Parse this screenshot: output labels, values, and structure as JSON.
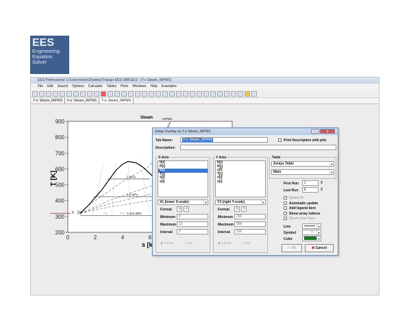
{
  "logo": {
    "title": "EES",
    "lines": [
      "Engineering",
      "Equation",
      "Solver"
    ]
  },
  "window": {
    "title": "EES Professional: C:\\Users\\koke\\Desktop\\Trabajo-EES-UBB.EES - [T-s Steam_IAPWS]",
    "menu": [
      "File",
      "Edit",
      "Search",
      "Options",
      "Calculate",
      "Tables",
      "Plots",
      "Windows",
      "Help",
      "Examples"
    ],
    "toolbar_icons": [
      "open-icon",
      "save-icon",
      "print-icon",
      "find-icon",
      "cut-icon",
      "copy-icon",
      "paste-icon",
      "equations-icon",
      "formatted-icon",
      "solution-icon",
      "check-icon",
      "calculator-icon",
      "table-icon",
      "plot-icon",
      "lookup-icon",
      "diagram-icon",
      "window1-icon",
      "window2-icon",
      "window3-icon",
      "window4-icon",
      "window5-icon",
      "window6-icon",
      "window7-icon",
      "window8-icon",
      "window9-icon",
      "window10-icon",
      "window11-icon",
      "window12-icon",
      "window13-icon",
      "window14-icon",
      "window15-icon",
      "help-icon",
      "report-icon"
    ],
    "tabs": [
      {
        "label": "T-s: Steam_IAPWS",
        "active": false
      },
      {
        "label": "h-s: Steam_IAPWS",
        "active": false
      },
      {
        "label": "T-s: Steam_IAPWS",
        "active": true
      }
    ]
  },
  "plot": {
    "title": "Steam",
    "title_sub": "IAPWS",
    "xlabel": "s [kJ/kg-K]",
    "ylabel": "T [K]",
    "xticks": [
      "0",
      "2",
      "4",
      "6"
    ],
    "yticks": [
      "200",
      "300",
      "400",
      "500",
      "600",
      "700",
      "800",
      "900"
    ],
    "isobar_labels": [
      "5 MPa",
      "0,5 MPa",
      "0,005 MPa"
    ],
    "quality_labels": [
      "0,2",
      "0,4",
      "0,6"
    ],
    "vline_label": "0,0058",
    "legend_label": "6",
    "legend_index": "[1]",
    "colors": {
      "dome": "#000000",
      "isobar": "#555555",
      "marker": "#cc2222"
    }
  },
  "dialog": {
    "title": "Setup Overlay on T-s Steam_IAPWS",
    "tab_name_label": "Tab Name:",
    "tab_name_value": "T-s: Steam_IAPWS",
    "print_desc_label": "Print Description with plot",
    "description_label": "Description:",
    "description_value": "",
    "x_axis": {
      "title": "X-Axis",
      "items": [
        "h[i]",
        "P[i]",
        "s[i]",
        "T[i]",
        "x[i]",
        "v[i]"
      ],
      "selected": "s[i]",
      "scale": "X1 (lower X-scale)",
      "format_label": "Format",
      "format_a": "A",
      "format_b": "4",
      "min_label": "Minimum",
      "min": "0",
      "max_label": "Maximum",
      "max": "12",
      "interval_label": "Interval",
      "interval": "2",
      "linear": "Linear",
      "log": "Log"
    },
    "y_axis": {
      "title": "Y-Axis",
      "items": [
        "h[i]",
        "P[i]",
        "s[i]",
        "T[i]",
        "x[i]",
        "v[i]"
      ],
      "scale": "Y2 (right Y-scale)",
      "format_label": "Format",
      "format_a": "E",
      "format_b": "0",
      "min_label": "Minimum",
      "min": "200",
      "max_label": "Maximum",
      "max": "900",
      "interval_label": "Interval",
      "interval": "100",
      "linear": "Linear",
      "log": "Log"
    },
    "table": {
      "title": "Table",
      "table_select": "Arrays Table",
      "sub_select": "Main"
    },
    "first_run_label": "First Run",
    "first_run": "1",
    "last_run_label": "Last Run",
    "last_run": "6",
    "options": [
      {
        "label": "Spline fit",
        "disabled": true
      },
      {
        "label": "Automatic update",
        "disabled": false
      },
      {
        "label": "Add legend item",
        "disabled": false
      },
      {
        "label": "Show array indices",
        "disabled": false
      },
      {
        "label": "Show error bars",
        "disabled": true
      }
    ],
    "line_label": "Line",
    "symbol_label": "Symbol",
    "symbol_value": "□",
    "color_label": "Color",
    "color_value": "#0a7a1a",
    "ok_label": "OK",
    "cancel_label": "Cancel"
  }
}
